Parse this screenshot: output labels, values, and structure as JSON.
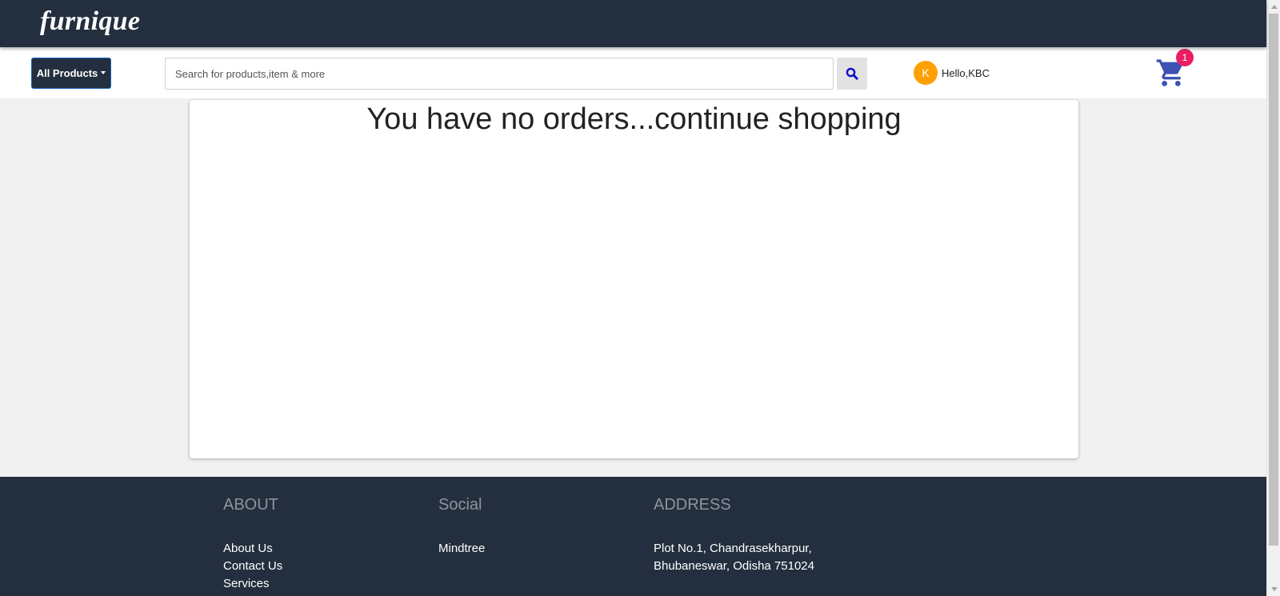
{
  "header": {
    "logo": "furnique"
  },
  "navbar": {
    "products_button": "All Products",
    "search_placeholder": "Search for products,item & more",
    "search_value": "",
    "user_initial": "K",
    "user_greeting": "Hello,KBC",
    "cart_count": "1"
  },
  "main": {
    "empty_message": "You have no orders...continue shopping"
  },
  "footer": {
    "about": {
      "heading": "ABOUT",
      "links": [
        "About Us",
        "Contact Us",
        "Services"
      ]
    },
    "social": {
      "heading": "Social",
      "links": [
        "Mindtree"
      ]
    },
    "address": {
      "heading": "ADDRESS",
      "lines": [
        "Plot No.1, Chandrasekharpur,",
        "Bhubaneswar, Odisha 751024"
      ]
    }
  },
  "colors": {
    "header_bg": "#232f3e",
    "cart_icon": "#3f51b5",
    "cart_badge": "#e91e63",
    "avatar": "#ffa000",
    "search_icon": "#0d0dcc"
  },
  "icons": {
    "search": "search-icon",
    "cart": "cart-icon",
    "dropdown": "caret-down-icon"
  }
}
